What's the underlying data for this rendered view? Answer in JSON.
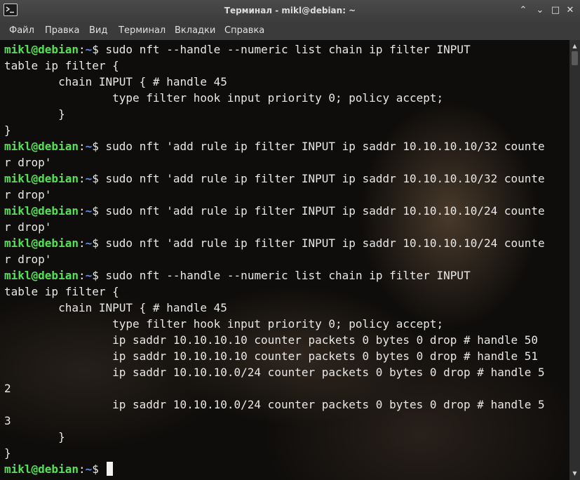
{
  "window": {
    "title": "Терминал - mikl@debian: ~",
    "controls": {
      "minimize": "⌃",
      "restore": "⌄",
      "maximize": "□",
      "close": "✕"
    }
  },
  "menubar": {
    "items": [
      "Файл",
      "Правка",
      "Вид",
      "Терминал",
      "Вкладки",
      "Справка"
    ]
  },
  "prompt": {
    "user_host": "mikl@debian",
    "colon": ":",
    "path": "~",
    "symbol": "$"
  },
  "terminal": {
    "lines": [
      {
        "prompt": true,
        "text": " sudo nft --handle --numeric list chain ip filter INPUT"
      },
      {
        "prompt": false,
        "text": "table ip filter {"
      },
      {
        "prompt": false,
        "text": "        chain INPUT { # handle 45"
      },
      {
        "prompt": false,
        "text": "                type filter hook input priority 0; policy accept;"
      },
      {
        "prompt": false,
        "text": "        }"
      },
      {
        "prompt": false,
        "text": "}"
      },
      {
        "prompt": true,
        "text": " sudo nft 'add rule ip filter INPUT ip saddr 10.10.10.10/32 counte"
      },
      {
        "prompt": false,
        "text": "r drop'"
      },
      {
        "prompt": true,
        "text": " sudo nft 'add rule ip filter INPUT ip saddr 10.10.10.10/32 counte"
      },
      {
        "prompt": false,
        "text": "r drop'"
      },
      {
        "prompt": true,
        "text": " sudo nft 'add rule ip filter INPUT ip saddr 10.10.10.10/24 counte"
      },
      {
        "prompt": false,
        "text": "r drop'"
      },
      {
        "prompt": true,
        "text": " sudo nft 'add rule ip filter INPUT ip saddr 10.10.10.10/24 counte"
      },
      {
        "prompt": false,
        "text": "r drop'"
      },
      {
        "prompt": true,
        "text": " sudo nft --handle --numeric list chain ip filter INPUT"
      },
      {
        "prompt": false,
        "text": "table ip filter {"
      },
      {
        "prompt": false,
        "text": "        chain INPUT { # handle 45"
      },
      {
        "prompt": false,
        "text": "                type filter hook input priority 0; policy accept;"
      },
      {
        "prompt": false,
        "text": "                ip saddr 10.10.10.10 counter packets 0 bytes 0 drop # handle 50"
      },
      {
        "prompt": false,
        "text": "                ip saddr 10.10.10.10 counter packets 0 bytes 0 drop # handle 51"
      },
      {
        "prompt": false,
        "text": "                ip saddr 10.10.10.0/24 counter packets 0 bytes 0 drop # handle 5"
      },
      {
        "prompt": false,
        "text": "2"
      },
      {
        "prompt": false,
        "text": "                ip saddr 10.10.10.0/24 counter packets 0 bytes 0 drop # handle 5"
      },
      {
        "prompt": false,
        "text": "3"
      },
      {
        "prompt": false,
        "text": "        }"
      },
      {
        "prompt": false,
        "text": "}"
      },
      {
        "prompt": true,
        "text": " ",
        "cursor": true
      }
    ]
  },
  "colors": {
    "user_host": "#55e055",
    "path": "#5a8df2",
    "text": "#e8e8e8",
    "cursor": "#f2f2f2"
  },
  "icons": {
    "app": "terminal-icon",
    "scroll_up": "arrow-up-icon",
    "scroll_down": "arrow-down-icon"
  },
  "scroll_glyphs": {
    "up": "▲",
    "down": "▼"
  }
}
